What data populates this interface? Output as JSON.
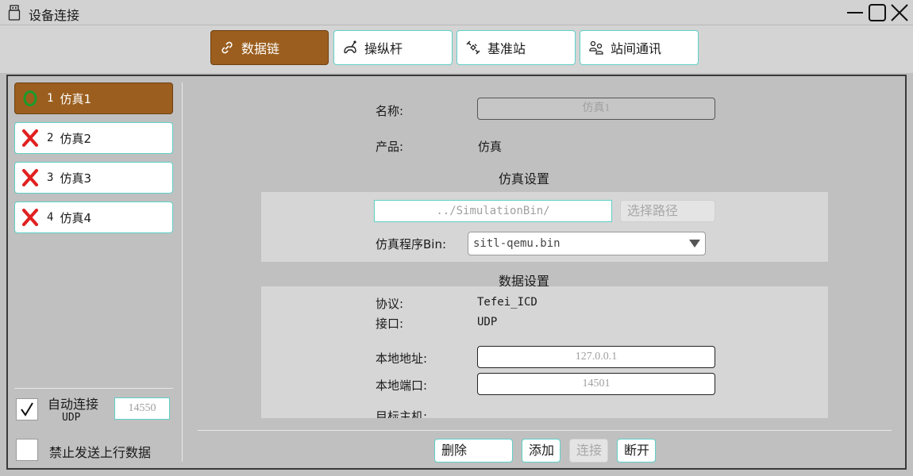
{
  "window": {
    "title": "设备连接",
    "icon": "usb-drive-icon",
    "controls": [
      "minimize-icon",
      "maximize-icon",
      "close-icon"
    ]
  },
  "tabs": [
    {
      "label": "数据链",
      "icon": "link-icon",
      "active": true
    },
    {
      "label": "操纵杆",
      "icon": "joystick-icon",
      "active": false
    },
    {
      "label": "基准站",
      "icon": "satellite-icon",
      "active": false
    },
    {
      "label": "站间通讯",
      "icon": "users-icon",
      "active": false
    }
  ],
  "devices": [
    {
      "num": "1",
      "name": "仿真1",
      "status": "connected",
      "status_color": "#1b9a2a",
      "active": true
    },
    {
      "num": "2",
      "name": "仿真2",
      "status": "disconnected",
      "status_color": "#e02020",
      "active": false
    },
    {
      "num": "3",
      "name": "仿真3",
      "status": "disconnected",
      "status_color": "#e02020",
      "active": false
    },
    {
      "num": "4",
      "name": "仿真4",
      "status": "disconnected",
      "status_color": "#e02020",
      "active": false
    }
  ],
  "left_options": {
    "auto_connect_label": "自动连接",
    "auto_connect_sub": "UDP",
    "auto_connect_checked": true,
    "udp_port": "14550",
    "disable_uplink_label": "禁止发送上行数据",
    "disable_uplink_checked": false
  },
  "detail": {
    "name_label": "名称:",
    "name_value": "仿真1",
    "product_label": "产品:",
    "product_value": "仿真",
    "sim_section_title": "仿真设置",
    "sim_path": "../SimulationBin/",
    "choose_path_label": "选择路径",
    "sim_bin_label": "仿真程序Bin:",
    "sim_bin_value": "sitl-qemu.bin",
    "data_section_title": "数据设置",
    "protocol_label": "协议:",
    "protocol_value": "Tefei_ICD",
    "interface_label": "接口:",
    "interface_value": "UDP",
    "local_addr_label": "本地地址:",
    "local_addr_value": "127.0.0.1",
    "local_port_label": "本地端口:",
    "local_port_value": "14501",
    "target_host_label": "目标主机:"
  },
  "actions": {
    "delete": "删除",
    "add": "添加",
    "connect": "连接",
    "disconnect": "断开"
  },
  "colors": {
    "accent": "#9b5e1e",
    "border_accent": "#5fd0c8"
  }
}
